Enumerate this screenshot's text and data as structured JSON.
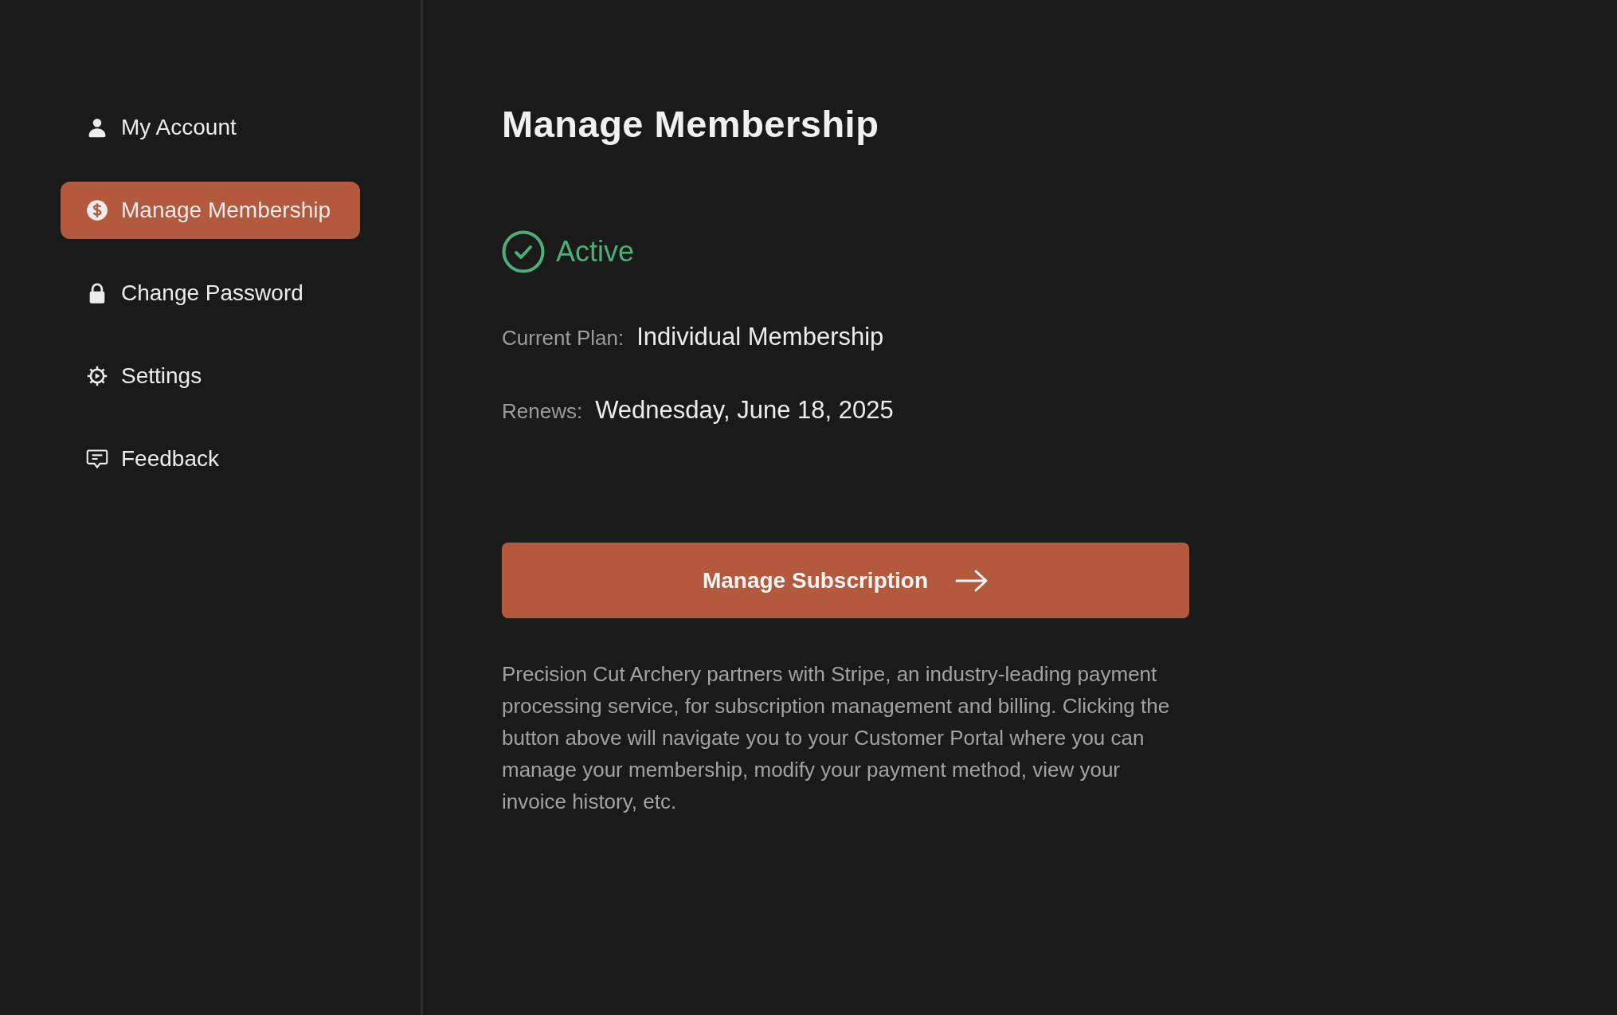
{
  "sidebar": {
    "items": [
      {
        "label": "My Account",
        "selected": false
      },
      {
        "label": "Manage Membership",
        "selected": true
      },
      {
        "label": "Change Password",
        "selected": false
      },
      {
        "label": "Settings",
        "selected": false
      },
      {
        "label": "Feedback",
        "selected": false
      }
    ]
  },
  "main": {
    "title": "Manage Membership",
    "status": {
      "label": "Active",
      "active": true
    },
    "details": [
      {
        "label": "Current Plan:",
        "value": "Individual Membership"
      },
      {
        "label": "Renews:",
        "value": "Wednesday, June 18, 2025"
      }
    ],
    "button": "Manage Subscription",
    "description": "Precision Cut Archery partners with Stripe, an industry-leading payment processing service, for subscription management and billing. Clicking the button above will navigate you to your Customer Portal where you can manage your membership, modify your payment method, view your invoice history, etc."
  }
}
